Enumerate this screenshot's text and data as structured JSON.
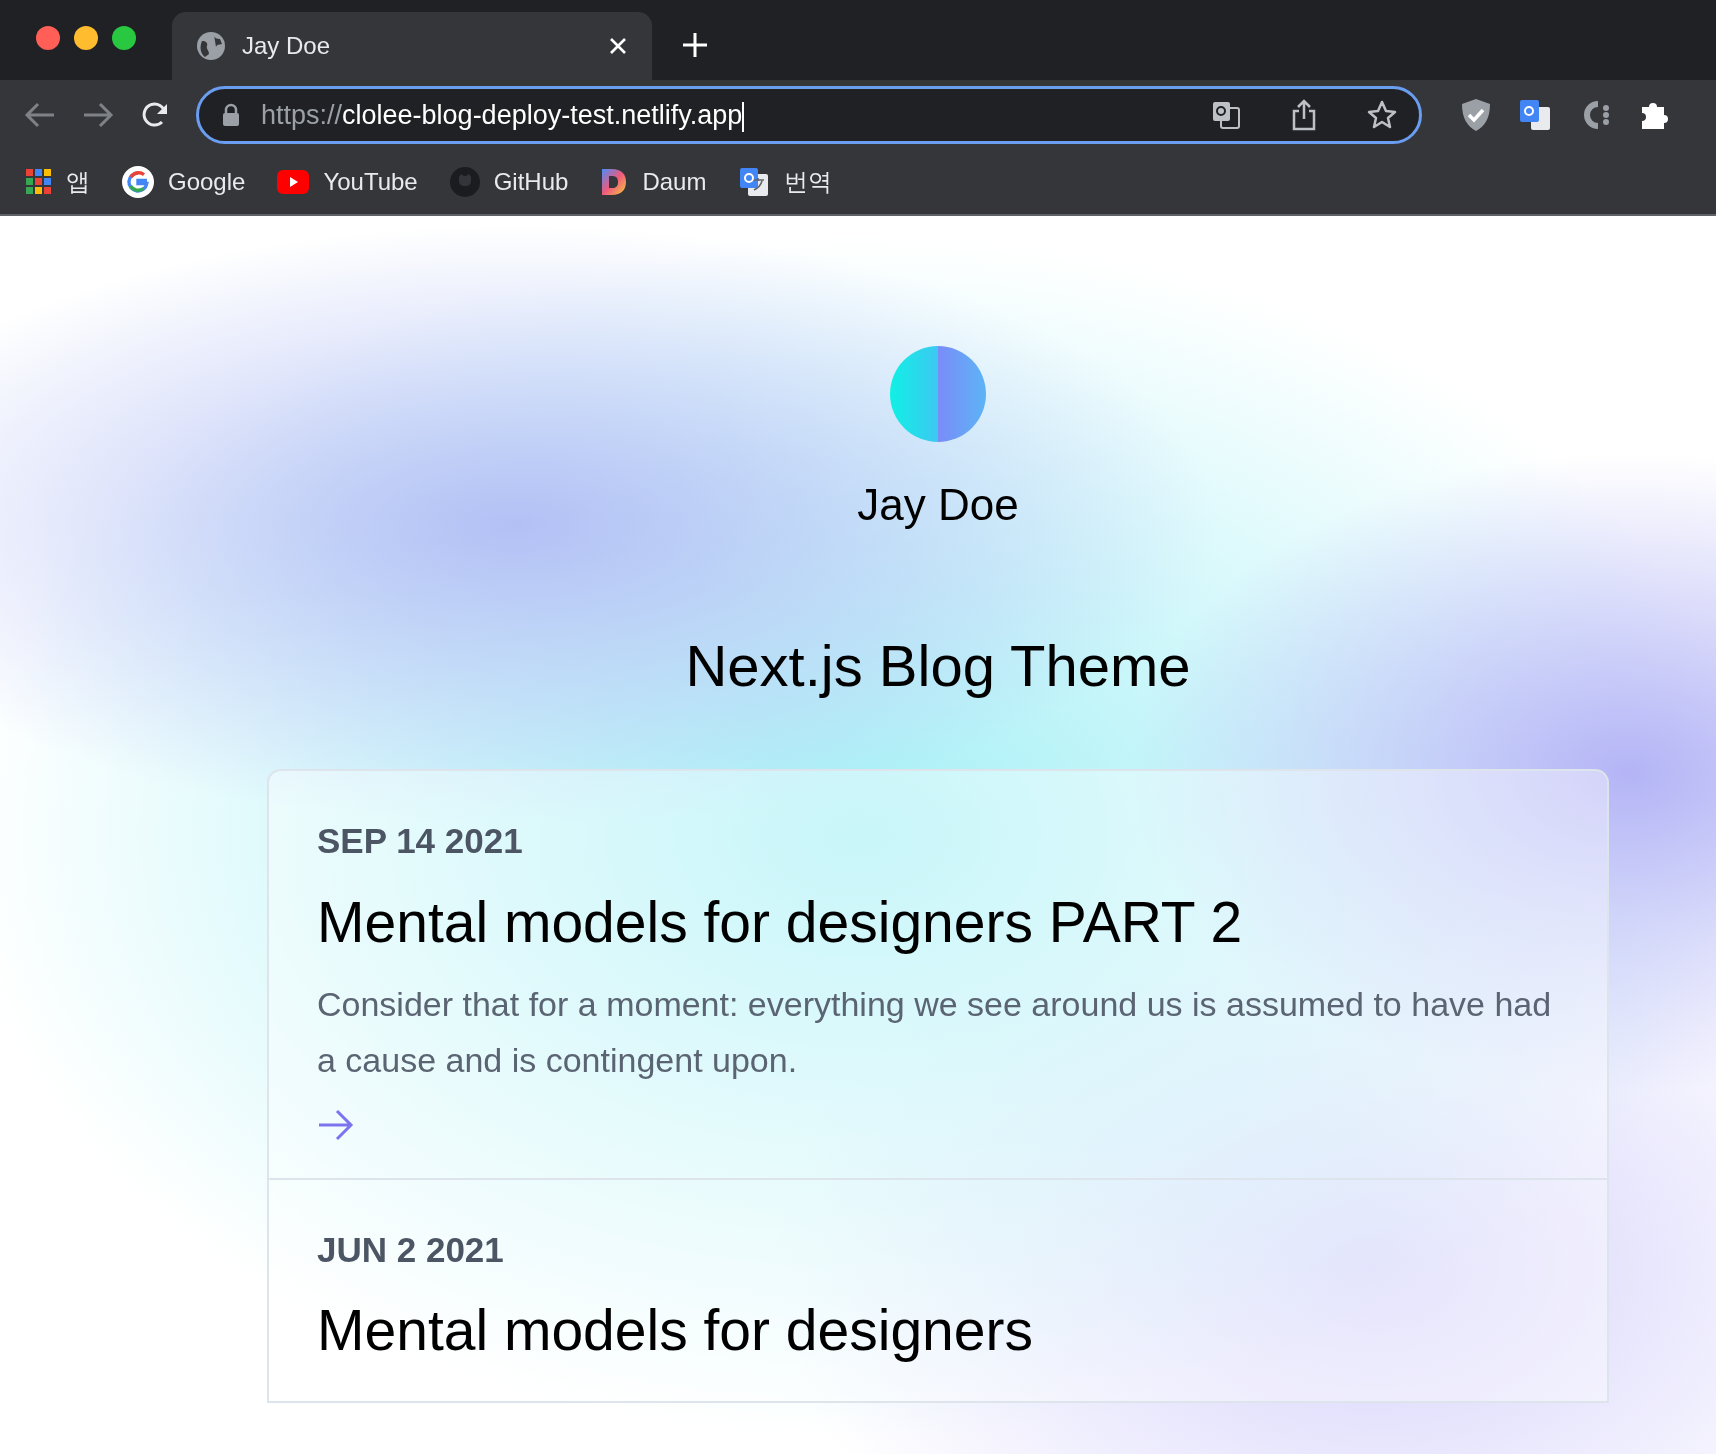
{
  "browser": {
    "tab": {
      "title": "Jay Doe"
    },
    "address": {
      "scheme": "https://",
      "host": "clolee-blog-deploy-test.netlify.app"
    },
    "bookmarks": [
      {
        "label": "앱",
        "kind": "apps"
      },
      {
        "label": "Google",
        "kind": "google"
      },
      {
        "label": "YouTube",
        "kind": "youtube"
      },
      {
        "label": "GitHub",
        "kind": "github"
      },
      {
        "label": "Daum",
        "kind": "daum"
      },
      {
        "label": "번역",
        "kind": "translate"
      }
    ]
  },
  "page": {
    "author": "Jay Doe",
    "title": "Next.js Blog Theme",
    "posts": [
      {
        "date": "SEP 14 2021",
        "title": "Mental models for designers PART 2",
        "excerpt": "Consider that for a moment: everything we see around us is assumed to have had a cause and is contingent upon."
      },
      {
        "date": "JUN 2 2021",
        "title": "Mental models for designers"
      }
    ]
  }
}
